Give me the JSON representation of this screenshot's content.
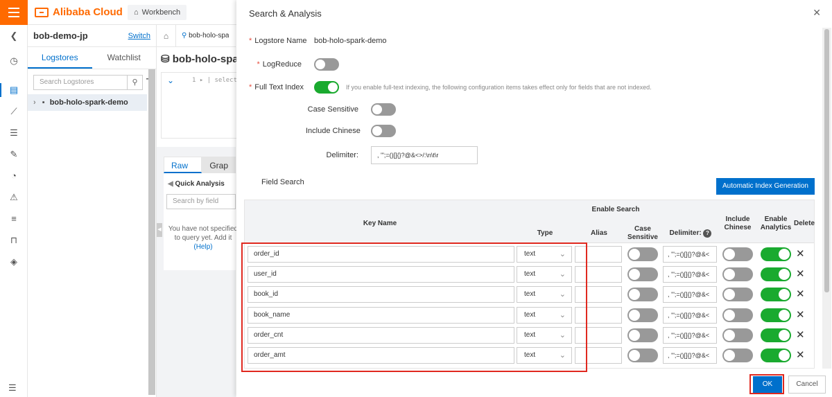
{
  "topbar": {
    "brand": "Alibaba Cloud",
    "workbench": "Workbench"
  },
  "project": {
    "name": "bob-demo-jp",
    "switch": "Switch",
    "tabs": [
      "Logstores",
      "Watchlist"
    ],
    "search_placeholder": "Search Logstores",
    "logstore": "bob-holo-spark-demo"
  },
  "middle": {
    "tab": "bob-holo-spa",
    "title": "bob-holo-spark",
    "editor_line": "1 ▸ | select",
    "log_tabs": [
      "Raw Logs",
      "Grap"
    ],
    "quick_analysis": "Quick Analysis",
    "search_placeholder": "Search by field",
    "empty_line1": "You have not specified",
    "empty_line2": "to query yet. Add it",
    "help": "(Help)"
  },
  "dialog": {
    "title": "Search & Analysis",
    "logstore_label": "Logstore Name",
    "logstore_value": "bob-holo-spark-demo",
    "logreduce_label": "LogReduce",
    "fulltext_label": "Full Text Index",
    "fulltext_hint": "If you enable full-text indexing, the following configuration items takes effect only for fields that are not indexed.",
    "case_label": "Case Sensitive",
    "chinese_label": "Include Chinese",
    "delimiter_label": "Delimiter:",
    "delimiter_value": ", '\";=()[]{}?@&<>/:\\n\\t\\r",
    "field_search": "Field Search",
    "auto_gen": "Automatic Index Generation",
    "ok": "OK",
    "cancel": "Cancel"
  },
  "table": {
    "headers": {
      "key_name": "Key Name",
      "enable_search": "Enable Search",
      "type": "Type",
      "alias": "Alias",
      "case": "Case Sensitive",
      "delimiter": "Delimiter:",
      "include_chinese": "Include Chinese",
      "enable_analytics": "Enable Analytics",
      "delete": "Delete"
    },
    "rows": [
      {
        "key": "order_id",
        "type": "text",
        "delimiter": ", '\";=()[]{}?@&<"
      },
      {
        "key": "user_id",
        "type": "text",
        "delimiter": ", '\";=()[]{}?@&<"
      },
      {
        "key": "book_id",
        "type": "text",
        "delimiter": ", '\";=()[]{}?@&<"
      },
      {
        "key": "book_name",
        "type": "text",
        "delimiter": ", '\";=()[]{}?@&<"
      },
      {
        "key": "order_cnt",
        "type": "text",
        "delimiter": ", '\";=()[]{}?@&<"
      },
      {
        "key": "order_amt",
        "type": "text",
        "delimiter": ", '\";=()[]{}?@&<"
      }
    ]
  }
}
